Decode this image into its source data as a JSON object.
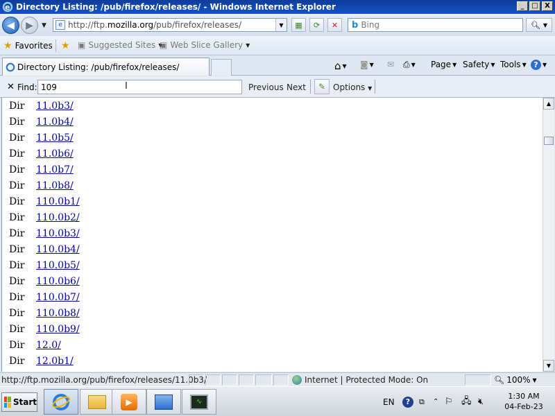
{
  "window": {
    "title": "Directory Listing: /pub/firefox/releases/ - Windows Internet Explorer",
    "controls": {
      "minimize": "_",
      "maximize": "□",
      "close": "X"
    }
  },
  "address_bar": {
    "url_prefix": "http://ftp.",
    "url_domain": "mozilla.org",
    "url_path": "/pub/firefox/releases/",
    "search_placeholder": "Bing"
  },
  "favorites_bar": {
    "favorites_label": "Favorites",
    "suggested_sites": "Suggested Sites",
    "web_slice_gallery": "Web Slice Gallery"
  },
  "tabs": [
    {
      "label": "Directory Listing: /pub/firefox/releases/"
    }
  ],
  "command_bar": {
    "page": "Page",
    "safety": "Safety",
    "tools": "Tools"
  },
  "find_bar": {
    "label": "Find:",
    "value": "109",
    "previous": "Previous",
    "next": "Next",
    "options": "Options"
  },
  "listing": [
    {
      "type": "Dir",
      "name": "11.0b3/"
    },
    {
      "type": "Dir",
      "name": "11.0b4/"
    },
    {
      "type": "Dir",
      "name": "11.0b5/"
    },
    {
      "type": "Dir",
      "name": "11.0b6/"
    },
    {
      "type": "Dir",
      "name": "11.0b7/"
    },
    {
      "type": "Dir",
      "name": "11.0b8/"
    },
    {
      "type": "Dir",
      "name": "110.0b1/"
    },
    {
      "type": "Dir",
      "name": "110.0b2/"
    },
    {
      "type": "Dir",
      "name": "110.0b3/"
    },
    {
      "type": "Dir",
      "name": "110.0b4/"
    },
    {
      "type": "Dir",
      "name": "110.0b5/"
    },
    {
      "type": "Dir",
      "name": "110.0b6/"
    },
    {
      "type": "Dir",
      "name": "110.0b7/"
    },
    {
      "type": "Dir",
      "name": "110.0b8/"
    },
    {
      "type": "Dir",
      "name": "110.0b9/"
    },
    {
      "type": "Dir",
      "name": "12.0/"
    },
    {
      "type": "Dir",
      "name": "12.0b1/"
    }
  ],
  "status_bar": {
    "url": "http://ftp.mozilla.org/pub/firefox/releases/11.0b3/",
    "zone": "Internet | Protected Mode: On",
    "zoom": "100%"
  },
  "taskbar": {
    "start_label": "Start",
    "language": "EN",
    "time": "1:30 AM",
    "date": "04-Feb-23"
  },
  "colors": {
    "link": "#0000aa",
    "title_bar": "#1452c6"
  }
}
